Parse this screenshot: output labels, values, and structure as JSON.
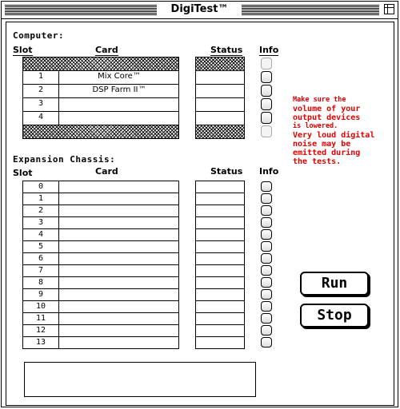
{
  "window": {
    "title": "DigiTest™"
  },
  "computer": {
    "heading": "Computer:",
    "col_slot": "Slot",
    "col_card": "Card",
    "col_status": "Status",
    "col_info": "Info",
    "rows": [
      {
        "slot": "",
        "card": "",
        "hatched": true
      },
      {
        "slot": "1",
        "card": "Mix Core™",
        "hatched": false
      },
      {
        "slot": "2",
        "card": "DSP Farm II™",
        "hatched": false
      },
      {
        "slot": "3",
        "card": "",
        "hatched": false
      },
      {
        "slot": "4",
        "card": "",
        "hatched": false
      },
      {
        "slot": "",
        "card": "",
        "hatched": true
      }
    ]
  },
  "warning": {
    "line1": "Make sure the",
    "line2": "volume of your",
    "line3": "output devices",
    "line4": "is lowered.",
    "line5": "Very loud digital",
    "line6": "noise may be",
    "line7": "emitted during",
    "line8": "the tests."
  },
  "expansion": {
    "heading": "Expansion Chassis:",
    "col_slot": "Slot",
    "col_card": "Card",
    "col_status": "Status",
    "col_info": "Info",
    "rows": [
      {
        "slot": "0",
        "card": ""
      },
      {
        "slot": "1",
        "card": ""
      },
      {
        "slot": "2",
        "card": ""
      },
      {
        "slot": "3",
        "card": ""
      },
      {
        "slot": "4",
        "card": ""
      },
      {
        "slot": "5",
        "card": ""
      },
      {
        "slot": "6",
        "card": ""
      },
      {
        "slot": "7",
        "card": ""
      },
      {
        "slot": "8",
        "card": ""
      },
      {
        "slot": "9",
        "card": ""
      },
      {
        "slot": "10",
        "card": ""
      },
      {
        "slot": "11",
        "card": ""
      },
      {
        "slot": "12",
        "card": ""
      },
      {
        "slot": "13",
        "card": ""
      }
    ]
  },
  "buttons": {
    "run": "Run",
    "stop": "Stop"
  },
  "colors": {
    "warning": "#e00000"
  }
}
